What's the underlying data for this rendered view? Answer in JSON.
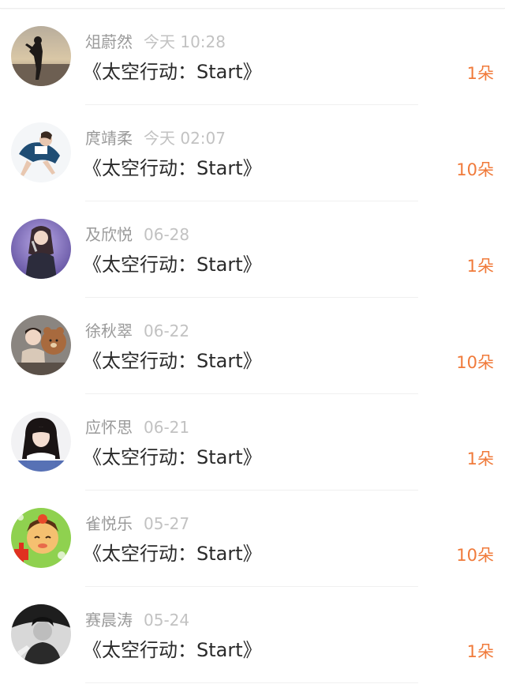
{
  "colors": {
    "name": "#9a9a9a",
    "time": "#c2c2c2",
    "title": "#2a2a2a",
    "amount": "#f07a3a"
  },
  "rows": [
    {
      "name": "俎蔚然",
      "time": "今天 10:28",
      "title": "《太空行动：Start》",
      "amount": "1朵",
      "avatar_icon": "person-silhouette-avatar"
    },
    {
      "name": "庹靖柔",
      "time": "今天 02:07",
      "title": "《太空行动：Start》",
      "amount": "10朵",
      "avatar_icon": "person-sitting-avatar"
    },
    {
      "name": "及欣悦",
      "time": "06-28",
      "title": "《太空行动：Start》",
      "amount": "1朵",
      "avatar_icon": "singer-avatar"
    },
    {
      "name": "徐秋翠",
      "time": "06-22",
      "title": "《太空行动：Start》",
      "amount": "10朵",
      "avatar_icon": "girl-with-bear-avatar"
    },
    {
      "name": "应怀思",
      "time": "06-21",
      "title": "《太空行动：Start》",
      "amount": "1朵",
      "avatar_icon": "girl-portrait-avatar"
    },
    {
      "name": "雀悦乐",
      "time": "05-27",
      "title": "《太空行动：Start》",
      "amount": "10朵",
      "avatar_icon": "cartoon-avatar"
    },
    {
      "name": "赛晨涛",
      "time": "05-24",
      "title": "《太空行动：Start》",
      "amount": "1朵",
      "avatar_icon": "bw-person-avatar"
    }
  ]
}
